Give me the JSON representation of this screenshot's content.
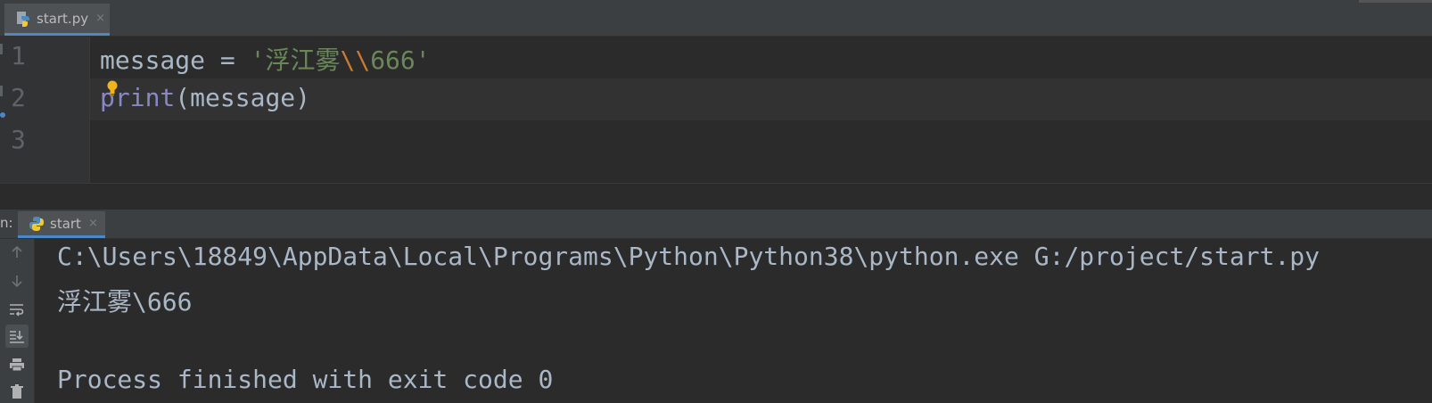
{
  "editor_tab": {
    "filename": "start.py",
    "close_glyph": "×"
  },
  "editor": {
    "line_numbers": [
      "1",
      "2",
      "3"
    ],
    "line1": {
      "var": "message",
      "op": " = ",
      "q1": "'",
      "str_before": "浮江雾",
      "escape": "\\\\",
      "str_after": "666",
      "q2": "'"
    },
    "line2": {
      "builtin": "print",
      "args": "(message)"
    }
  },
  "run_window": {
    "prefix": "n:",
    "tab_label": "start",
    "close_glyph": "×"
  },
  "console": {
    "command": "C:\\Users\\18849\\AppData\\Local\\Programs\\Python\\Python38\\python.exe G:/project/start.py",
    "output": "浮江雾\\666",
    "exit_message": "Process finished with exit code 0"
  },
  "colors": {
    "accent": "#4a88c7",
    "string": "#6a8759",
    "escape": "#cc7832",
    "builtin": "#8888c6",
    "text": "#a9b7c6"
  },
  "toolbar_icons": [
    "arrow-up-icon",
    "arrow-down-icon",
    "soft-wrap-icon",
    "scroll-to-end-icon",
    "print-icon",
    "delete-icon"
  ]
}
